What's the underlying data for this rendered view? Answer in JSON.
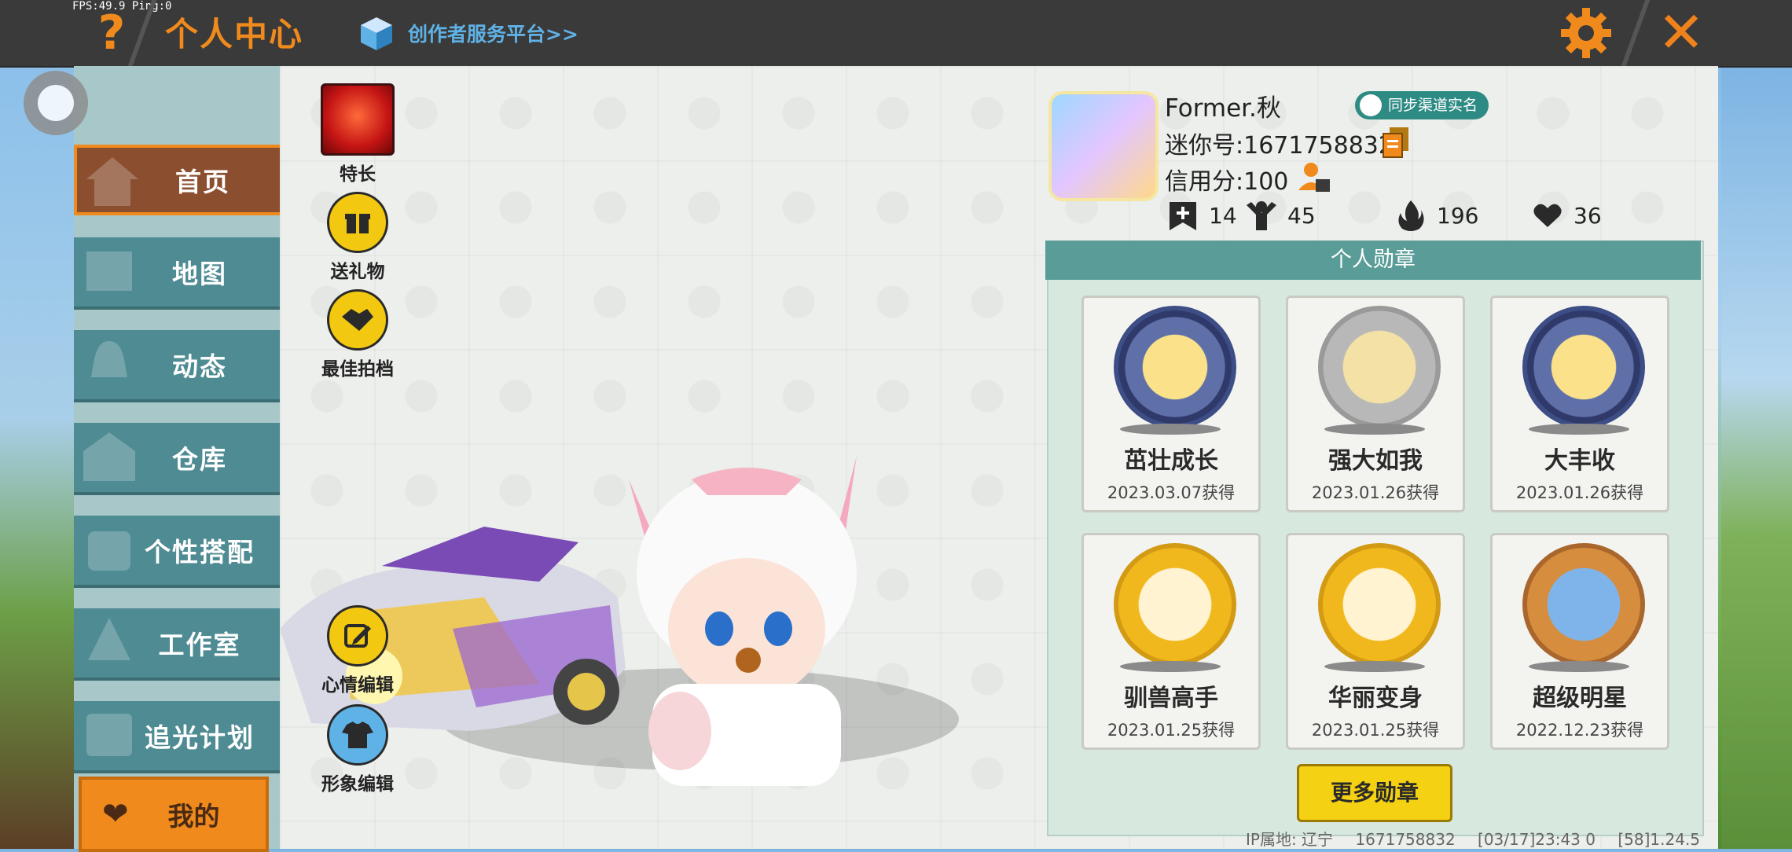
{
  "topbar": {
    "fps": "FPS:49.9  Ping:0",
    "help_icon": "?",
    "title": "个人中心",
    "creator_link": "创作者服务平台>>",
    "close_icon": "✕"
  },
  "nav": {
    "items": [
      {
        "label": "首页",
        "icon": "house-icon",
        "active": true
      },
      {
        "label": "地图",
        "icon": "map-icon"
      },
      {
        "label": "动态",
        "icon": "bell-icon"
      },
      {
        "label": "仓库",
        "icon": "warehouse-icon"
      },
      {
        "label": "个性搭配",
        "icon": "outfit-icon"
      },
      {
        "label": "工作室",
        "icon": "studio-icon"
      },
      {
        "label": "追光计划",
        "icon": "light-plan-icon"
      }
    ],
    "mine": {
      "label": "我的",
      "icon": "heart-icon"
    }
  },
  "skills": {
    "talent": "特长",
    "gift": "送礼物",
    "partner": "最佳拍档",
    "mood": "心情编辑",
    "image": "形象编辑"
  },
  "profile": {
    "name": "Former.秋",
    "sync_badge": "同步渠道实名",
    "mini_id": "迷你号:1671758832",
    "credit": "信用分:100",
    "stats": [
      {
        "icon": "add-friend-icon",
        "value": "14"
      },
      {
        "icon": "fans-icon",
        "value": "45"
      },
      {
        "icon": "fire-icon",
        "value": "196"
      },
      {
        "icon": "hearts-icon",
        "value": "36"
      }
    ]
  },
  "medals": {
    "header": "个人勋章",
    "items": [
      {
        "name": "茁壮成长",
        "date": "2023.03.07获得",
        "style": "blue"
      },
      {
        "name": "强大如我",
        "date": "2023.01.26获得",
        "style": "silver"
      },
      {
        "name": "大丰收",
        "date": "2023.01.26获得",
        "style": "blue"
      },
      {
        "name": "驯兽高手",
        "date": "2023.01.25获得",
        "style": "gold"
      },
      {
        "name": "华丽变身",
        "date": "2023.01.25获得",
        "style": "gold"
      },
      {
        "name": "超级明星",
        "date": "2022.12.23获得",
        "style": "bronze"
      }
    ],
    "more_button": "更多勋章"
  },
  "footer": {
    "ip": "IP属地: 辽宁",
    "uid": "1671758832",
    "time": "[03/17]23:43 0",
    "version": "[58]1.24.5"
  },
  "colors": {
    "accent": "#f08a1c",
    "nav": "#4e8b93",
    "medal_header": "#5a9c97",
    "button": "#f4d112"
  }
}
